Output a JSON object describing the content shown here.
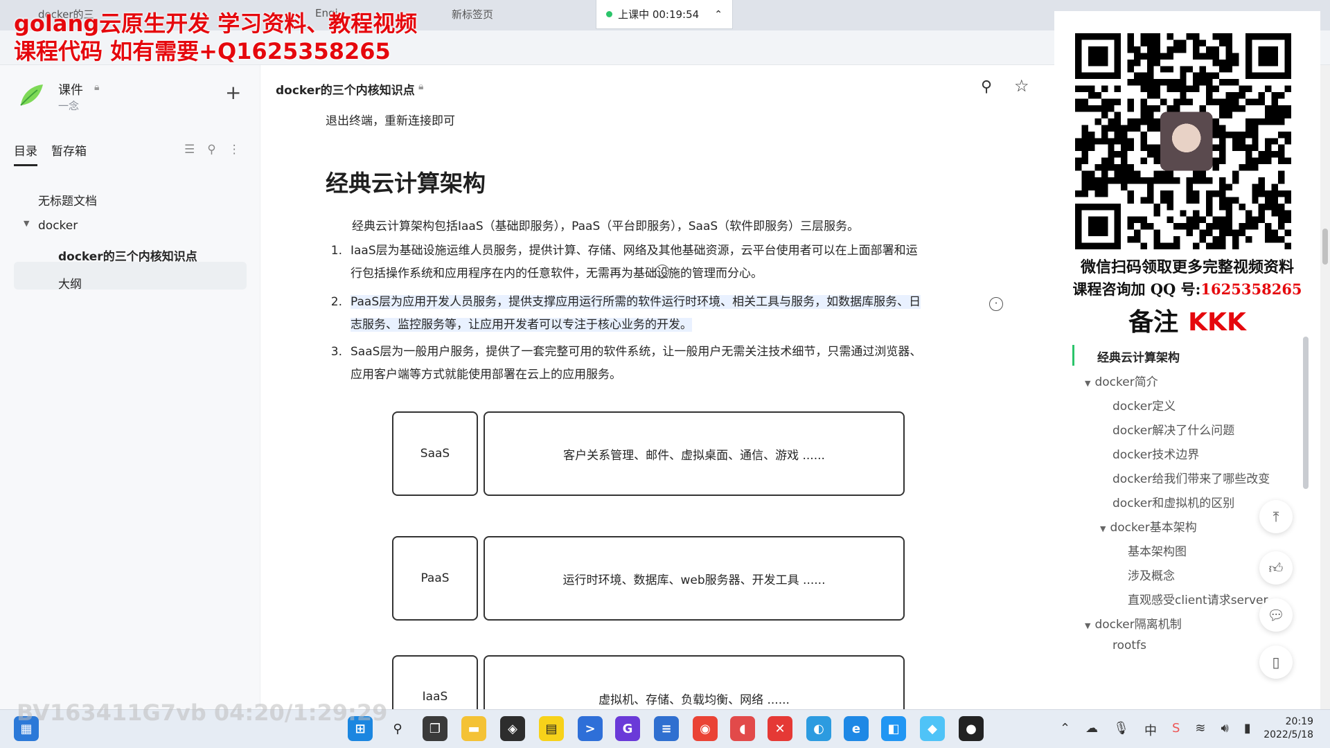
{
  "promo": {
    "line1": "golang云原生开发 学习资料、教程视频",
    "line2": "课程代码 如有需要+Q1625358265"
  },
  "browser": {
    "tabs": [
      "docker的三",
      "Engi",
      "新标签页"
    ],
    "class_status": "上课中 00:19:54"
  },
  "sidebar": {
    "kb_title": "课件",
    "kb_owner": "一念",
    "tabs": {
      "catalog": "目录",
      "drafts": "暂存箱"
    },
    "tree": {
      "untitled": "无标题文档",
      "docker": "docker",
      "current": "docker的三个内核知识点",
      "outline": "大纲"
    }
  },
  "doc": {
    "title": "docker的三个内核知识点",
    "exit_line": "退出终端，重新连接即可",
    "heading": "经典云计算架构",
    "intro": "经典云计算架构包括IaaS（基础即服务），PaaS（平台即服务），SaaS（软件即服务）三层服务。",
    "list": [
      {
        "num": "1.",
        "line1": "IaaS层为基础设施运维人员服务，提供计算、存储、网络及其他基础资源，云平台使用者可以在上面部署和运",
        "line2": "行包括操作系统和应用程序在内的任意软件，无需再为基础设施的管理而分心。"
      },
      {
        "num": "2.",
        "line1": "PaaS层为应用开发人员服务，提供支撑应用运行所需的软件运行时环境、相关工具与服务，如数据库服务、日",
        "line2": "志服务、监控服务等，让应用开发者可以专注于核心业务的开发。"
      },
      {
        "num": "3.",
        "line1": "SaaS层为一般用户服务，提供了一套完整可用的软件系统，让一般用户无需关注技术细节，只需通过浏览器、",
        "line2": "应用客户端等方式就能使用部署在云上的应用服务。"
      }
    ],
    "diagram": {
      "saas": {
        "label": "SaaS",
        "desc": "客户关系管理、邮件、虚拟桌面、通信、游戏 ......"
      },
      "paas": {
        "label": "PaaS",
        "desc": "运行时环境、数据库、web服务器、开发工具 ......"
      },
      "iaas": {
        "label": "IaaS",
        "desc": "虚拟机、存储、负载均衡、网络 ......"
      }
    }
  },
  "qr": {
    "line1": "微信扫码领取更多完整视频资料",
    "line2_prefix": "课程咨询加 QQ 号:",
    "line2_qq": "1625358265",
    "line3_prefix": "备注",
    "line3_code": "KKK"
  },
  "outline": {
    "items": [
      {
        "label": "经典云计算架构",
        "level": 0,
        "active": true
      },
      {
        "label": "docker简介",
        "level": 0,
        "expanded": true
      },
      {
        "label": "docker定义",
        "level": 1
      },
      {
        "label": "docker解决了什么问题",
        "level": 1
      },
      {
        "label": "docker技术边界",
        "level": 1
      },
      {
        "label": "docker给我们带来了哪些改变",
        "level": 1
      },
      {
        "label": "docker和虚拟机的区别",
        "level": 1
      },
      {
        "label": "docker基本架构",
        "level": 1,
        "expanded": true
      },
      {
        "label": "基本架构图",
        "level": 2
      },
      {
        "label": "涉及概念",
        "level": 2
      },
      {
        "label": "直观感受client请求server",
        "level": 2
      },
      {
        "label": "docker隔离机制",
        "level": 0,
        "expanded": true
      },
      {
        "label": "rootfs",
        "level": 1
      }
    ]
  },
  "video_watermark": "BV163411G7vb 04:20/1:29:29",
  "taskbar": {
    "time": "20:19",
    "date": "2022/5/18"
  },
  "colors": {
    "promo_red": "#e5080d",
    "highlight_bg": "#e9f1ff",
    "active_outline": "#2bc46a"
  }
}
